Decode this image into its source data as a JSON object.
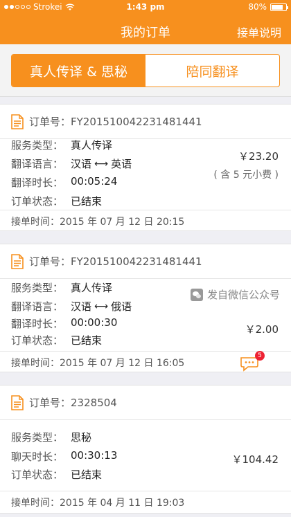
{
  "status_bar": {
    "carrier": "Strokei",
    "time": "1:43 pm",
    "battery": "80%"
  },
  "nav": {
    "title": "我的订单",
    "right_action": "接单说明"
  },
  "tabs": [
    {
      "label": "真人传译 & 思秘",
      "active": true
    },
    {
      "label": "陪同翻译",
      "active": false
    }
  ],
  "labels": {
    "order_no": "订单号：",
    "service_type": "服务类型：",
    "language": "翻译语言：",
    "duration": "翻译时长：",
    "chat_duration": "聊天时长：",
    "status": "订单状态：",
    "accept_time": "接单时间："
  },
  "orders": [
    {
      "order_no": "FY201510042231481441",
      "service_type": "真人传译",
      "lang_from": "汉语",
      "lang_to": "英语",
      "duration": "00:05:24",
      "status": "已结束",
      "price": "￥23.20",
      "tip": "( 含 5 元小费 )",
      "accept_time": "2015 年 07 月 12 日 20:15"
    },
    {
      "order_no": "FY201510042231481441",
      "service_type": "真人传译",
      "lang_from": "汉语",
      "lang_to": "俄语",
      "duration": "00:00:30",
      "status": "已结束",
      "price": "￥2.00",
      "wechat_note": "发自微信公众号",
      "message_badge": "5",
      "accept_time": "2015 年 07 月 12 日 16:05"
    },
    {
      "order_no": "2328504",
      "service_type": "思秘",
      "duration": "00:30:13",
      "status": "已结束",
      "price": "￥104.42",
      "accept_time": "2015 年 04 月 11 日 19:03"
    }
  ],
  "colors": {
    "accent": "#f7901e",
    "background": "#efeff4",
    "badge": "#ee2233"
  },
  "icons": [
    "wifi-icon",
    "battery-icon",
    "document-icon",
    "wechat-icon",
    "chat-bubble-icon",
    "double-arrow-icon"
  ]
}
